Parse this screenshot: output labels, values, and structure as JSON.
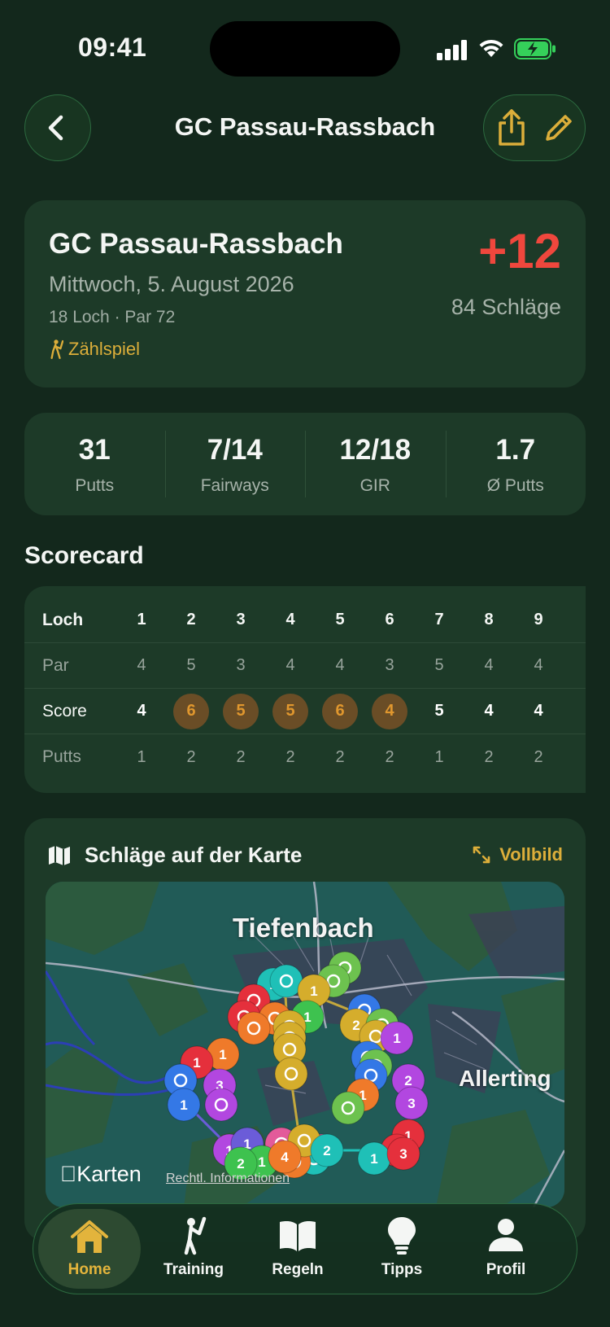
{
  "status_bar": {
    "time": "09:41"
  },
  "header": {
    "title": "GC Passau-Rassbach"
  },
  "round": {
    "course": "GC Passau-Rassbach",
    "date": "Mittwoch, 5. August 2026",
    "meta": "18 Loch · Par 72",
    "mode": "Zählspiel",
    "relative_score": "+12",
    "strokes": "84 Schläge"
  },
  "stats": [
    {
      "value": "31",
      "label": "Putts"
    },
    {
      "value": "7/14",
      "label": "Fairways"
    },
    {
      "value": "12/18",
      "label": "GIR"
    },
    {
      "value": "1.7",
      "label": "Ø Putts"
    }
  ],
  "scorecard": {
    "title": "Scorecard",
    "row_labels": {
      "hole": "Loch",
      "par": "Par",
      "score": "Score",
      "putts": "Putts"
    },
    "holes": [
      "1",
      "2",
      "3",
      "4",
      "5",
      "6",
      "7",
      "8",
      "9"
    ],
    "par": [
      "4",
      "5",
      "3",
      "4",
      "4",
      "3",
      "5",
      "4",
      "4"
    ],
    "score": [
      "4",
      "6",
      "5",
      "5",
      "6",
      "4",
      "5",
      "4",
      "4"
    ],
    "over_par": [
      false,
      true,
      true,
      true,
      true,
      true,
      false,
      false,
      false
    ],
    "putts": [
      "1",
      "2",
      "2",
      "2",
      "2",
      "2",
      "1",
      "2",
      "2"
    ]
  },
  "map": {
    "title": "Schläge auf der Karte",
    "fullscreen_label": "Vollbild",
    "place_labels": [
      "Tiefenbach",
      "Allerting"
    ],
    "attribution": "Karten",
    "legal": "Rechtl. Informationen"
  },
  "tabs": [
    {
      "label": "Home",
      "icon": "house-icon",
      "active": true
    },
    {
      "label": "Training",
      "icon": "golfer-icon",
      "active": false
    },
    {
      "label": "Regeln",
      "icon": "book-icon",
      "active": false
    },
    {
      "label": "Tipps",
      "icon": "lightbulb-icon",
      "active": false
    },
    {
      "label": "Profil",
      "icon": "person-icon",
      "active": false
    }
  ],
  "colors": {
    "background": "#13281c",
    "card": "#1d3a28",
    "accent_gold": "#dcae3a",
    "over_par_red": "#f0473d"
  }
}
